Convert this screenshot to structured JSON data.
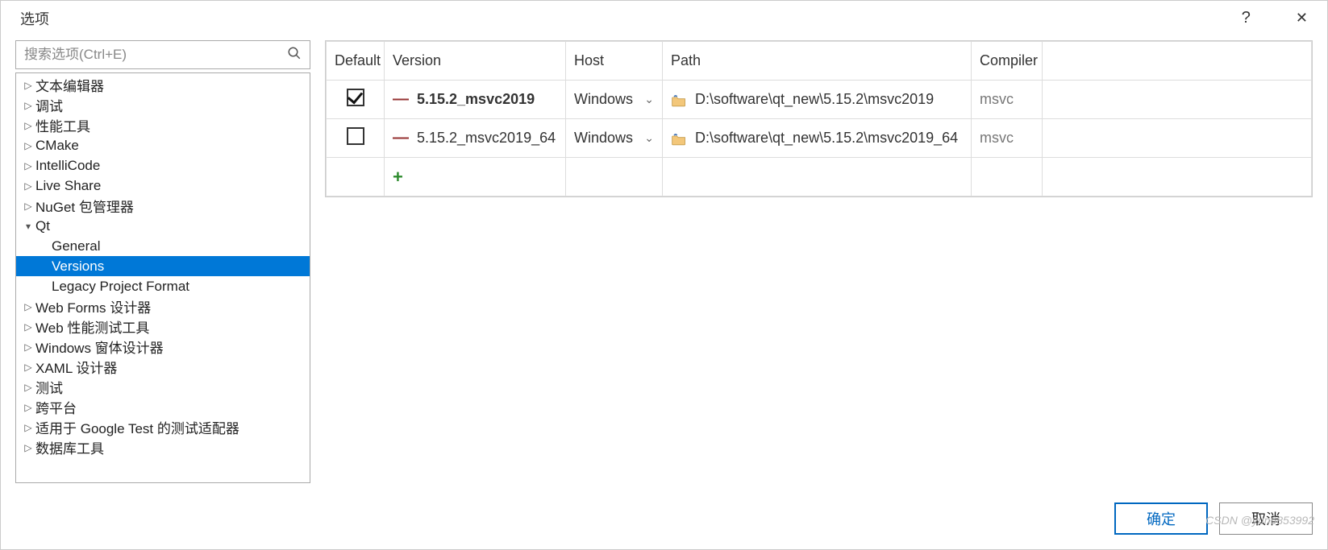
{
  "title": "选项",
  "search": {
    "placeholder": "搜索选项(Ctrl+E)"
  },
  "sidebar": {
    "items": [
      {
        "label": "文本编辑器",
        "expanded": false,
        "level": 0
      },
      {
        "label": "调试",
        "expanded": false,
        "level": 0
      },
      {
        "label": "性能工具",
        "expanded": false,
        "level": 0
      },
      {
        "label": "CMake",
        "expanded": false,
        "level": 0
      },
      {
        "label": "IntelliCode",
        "expanded": false,
        "level": 0
      },
      {
        "label": "Live Share",
        "expanded": false,
        "level": 0
      },
      {
        "label": "NuGet 包管理器",
        "expanded": false,
        "level": 0
      },
      {
        "label": "Qt",
        "expanded": true,
        "level": 0
      },
      {
        "label": "General",
        "level": 1
      },
      {
        "label": "Versions",
        "level": 1,
        "selected": true
      },
      {
        "label": "Legacy Project Format",
        "level": 1
      },
      {
        "label": "Web Forms 设计器",
        "expanded": false,
        "level": 0
      },
      {
        "label": "Web 性能测试工具",
        "expanded": false,
        "level": 0
      },
      {
        "label": "Windows 窗体设计器",
        "expanded": false,
        "level": 0
      },
      {
        "label": "XAML 设计器",
        "expanded": false,
        "level": 0
      },
      {
        "label": "测试",
        "expanded": false,
        "level": 0
      },
      {
        "label": "跨平台",
        "expanded": false,
        "level": 0
      },
      {
        "label": "适用于 Google Test 的测试适配器",
        "expanded": false,
        "level": 0
      },
      {
        "label": "数据库工具",
        "expanded": false,
        "level": 0
      }
    ]
  },
  "table": {
    "headers": {
      "default": "Default",
      "version": "Version",
      "host": "Host",
      "path": "Path",
      "compiler": "Compiler"
    },
    "rows": [
      {
        "default": true,
        "version": "5.15.2_msvc2019",
        "bold": true,
        "host": "Windows",
        "path": "D:\\software\\qt_new\\5.15.2\\msvc2019",
        "compiler": "msvc"
      },
      {
        "default": false,
        "version": "5.15.2_msvc2019_64",
        "bold": false,
        "host": "Windows",
        "path": "D:\\software\\qt_new\\5.15.2\\msvc2019_64",
        "compiler": "msvc"
      }
    ],
    "add_placeholder": "<add new Qt version>"
  },
  "buttons": {
    "ok": "确定",
    "cancel": "取消"
  },
  "watermark": "CSDN @yun6853992"
}
